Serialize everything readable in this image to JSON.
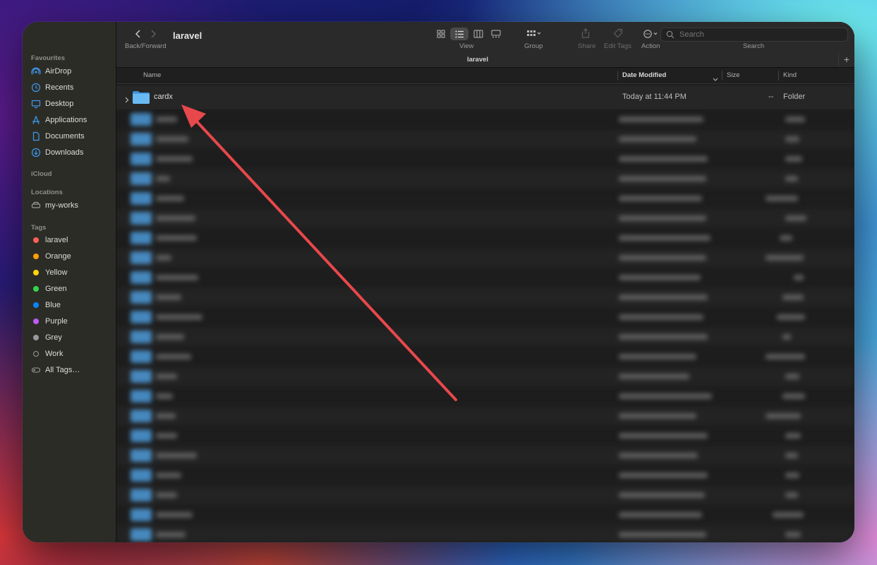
{
  "sidebar": {
    "favourites_label": "Favourites",
    "favourites": [
      {
        "label": "AirDrop",
        "icon": "airdrop-icon"
      },
      {
        "label": "Recents",
        "icon": "clock-icon"
      },
      {
        "label": "Desktop",
        "icon": "desktop-icon"
      },
      {
        "label": "Applications",
        "icon": "applications-icon"
      },
      {
        "label": "Documents",
        "icon": "document-icon"
      },
      {
        "label": "Downloads",
        "icon": "download-icon"
      }
    ],
    "icloud_label": "iCloud",
    "locations_label": "Locations",
    "locations": [
      {
        "label": "my-works",
        "icon": "drive-icon"
      }
    ],
    "tags_label": "Tags",
    "tags": [
      {
        "label": "laravel",
        "color": "#ff5f57"
      },
      {
        "label": "Orange",
        "color": "#ff9f0a"
      },
      {
        "label": "Yellow",
        "color": "#ffd60a"
      },
      {
        "label": "Green",
        "color": "#32d74b"
      },
      {
        "label": "Blue",
        "color": "#0a84ff"
      },
      {
        "label": "Purple",
        "color": "#bf5af2"
      },
      {
        "label": "Grey",
        "color": "#98989d"
      },
      {
        "label": "Work",
        "color": ""
      },
      {
        "label": "All Tags…",
        "color": ""
      }
    ]
  },
  "toolbar": {
    "title": "laravel",
    "back_forward_label": "Back/Forward",
    "view_label": "View",
    "group_label": "Group",
    "share_label": "Share",
    "edit_tags_label": "Edit Tags",
    "action_label": "Action",
    "search_label": "Search",
    "search_placeholder": "Search"
  },
  "tabbar": {
    "tab_title": "laravel",
    "add_tab": "+"
  },
  "columns": {
    "name": "Name",
    "date_modified": "Date Modified",
    "size": "Size",
    "kind": "Kind"
  },
  "first_row": {
    "name": "cardx",
    "date_modified": "Today at 11:44 PM",
    "size": "--",
    "kind": "Folder"
  },
  "colors": {
    "accent_arrow": "#e8484c",
    "folder_blue": "#5fb3f0"
  }
}
